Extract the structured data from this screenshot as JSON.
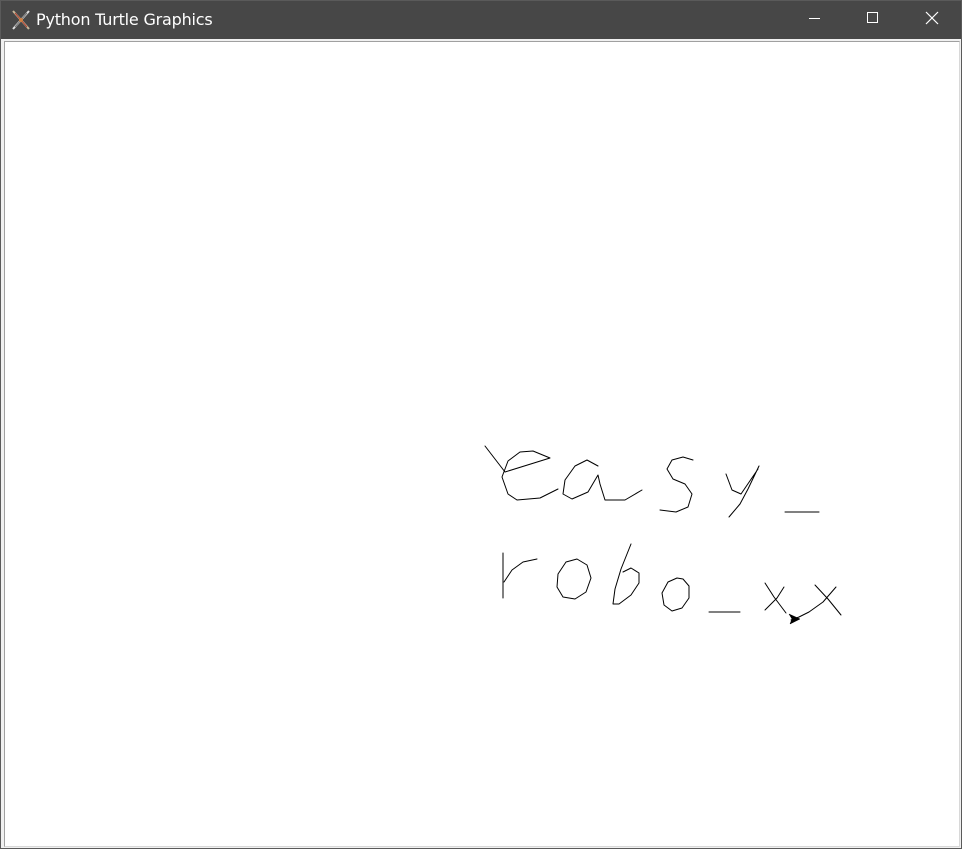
{
  "window": {
    "title": "Python Turtle Graphics",
    "app_icon": "turtle-feather-icon",
    "controls": {
      "minimize_icon": "minimize-icon",
      "maximize_icon": "maximize-icon",
      "close_icon": "close-icon"
    }
  },
  "colors": {
    "titlebar": "#474747",
    "title_text": "#ffffff",
    "canvas_background": "#ffffff",
    "pen": "#000000"
  },
  "canvas": {
    "handwriting": {
      "line_1": "easy_",
      "line_2": "robo_xx"
    },
    "turtle_cursor": "arrow-cursor-icon"
  }
}
